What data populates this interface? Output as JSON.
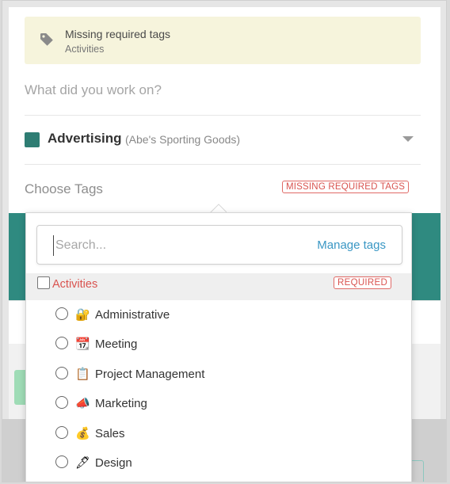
{
  "banner": {
    "title": "Missing required tags",
    "subtitle": "Activities",
    "icon": "tag-icon"
  },
  "entry": {
    "notes_placeholder": "What did you work on?",
    "project": {
      "name": "Advertising",
      "client": "(Abe's Sporting Goods)",
      "color": "#2e7d73"
    },
    "choose_tags_label": "Choose Tags",
    "missing_badge": "MISSING REQUIRED TAGS"
  },
  "dropdown": {
    "search_placeholder": "Search...",
    "search_value": "",
    "manage_tags_label": "Manage tags",
    "group": {
      "label": "Activities",
      "badge": "REQUIRED"
    },
    "tags": [
      {
        "emoji": "🔐",
        "label": "Administrative"
      },
      {
        "emoji": "📆",
        "label": "Meeting"
      },
      {
        "emoji": "📋",
        "label": "Project Management"
      },
      {
        "emoji": "📣",
        "label": "Marketing"
      },
      {
        "emoji": "💰",
        "label": "Sales"
      },
      {
        "emoji": "🖋",
        "label": "Design"
      }
    ]
  },
  "colors": {
    "accent_teal": "#2f8a80",
    "required_red": "#d9534f",
    "link_blue": "#3a97c4",
    "banner_bg": "#f6f4dc"
  }
}
